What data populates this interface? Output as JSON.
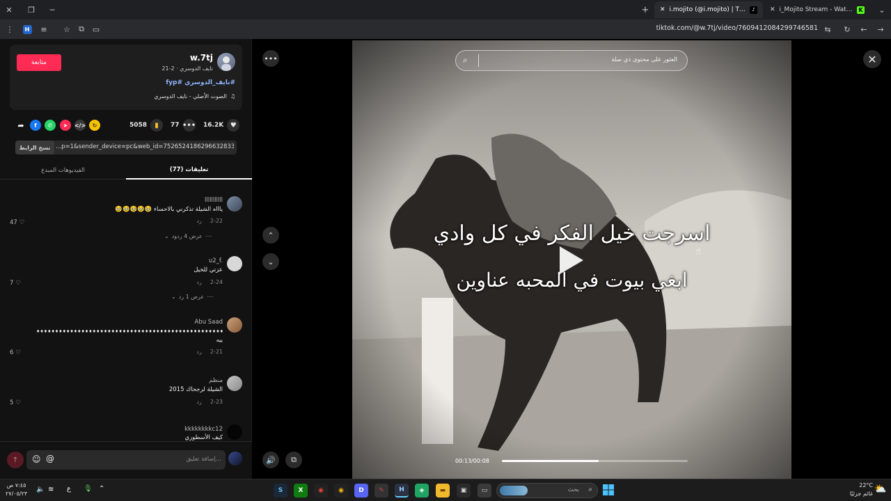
{
  "browser": {
    "tabs": [
      {
        "label": "i_Mojito Stream - Watch Liv"
      },
      {
        "label": "i.mojito (@i.mojito) | TikTok"
      }
    ],
    "url": "tiktok.com/@w.7tj/video/7609412084299746581"
  },
  "post": {
    "follow_label": "متابعة",
    "username": "w.7tj",
    "subline": "نايف الدوسري · 2-21",
    "hashtags": "#نايف_الدوسري #fyp",
    "sound": "الصوت الأصلي - نايف الدوسري",
    "likes": "16.2K",
    "comments": "77",
    "saves": "5058",
    "link": "...p=1&sender_device=pc&web_id=7526524186296632833",
    "copy_label": "نسخ الرابط",
    "tab_comments": "تعليقات (77)",
    "tab_creator": "الفيديوهات المبدع"
  },
  "comments": [
    {
      "name": "lllllllllll",
      "text": "ياااه الشيلة تذكرني بالاحساء 🥹🥹🥹🥹🥹",
      "date": "2-22",
      "reply": "رد",
      "likes": "47",
      "replies": "عرض 4 ردود"
    },
    {
      "name": "u2_f.",
      "text": "عزتي للخيل",
      "date": "2-24",
      "reply": "رد",
      "likes": "7",
      "replies": "عرض 1 رد"
    },
    {
      "name": "Abu Saad",
      "text": "♦♦♦♦♦♦♦♦♦♦♦♦♦♦♦♦♦♦♦♦♦♦♦♦♦♦♦♦♦♦♦♦♦♦♦♦♦♦♦♦♦♦♦♦♦♦♦♦♦♦♦♦♦♦♦♦♦♦♦♦♦♦♦♦♦♦♦♦♦♦♦♦♦♦♦♦♦♦♦♦♦",
      "text2": "ييه",
      "date": "2-21",
      "reply": "رد",
      "likes": "6"
    },
    {
      "name": "منظم",
      "text": "الشيلة لرجحاك 2015",
      "date": "2-23",
      "reply": "رد",
      "likes": "5"
    },
    {
      "name": "kkkkkkkkc12",
      "text": "كيف الأسطوري"
    }
  ],
  "input": {
    "placeholder": "إضافة تعليق..."
  },
  "video": {
    "search_placeholder": "العثور على محتوى ذي صلة",
    "caption_line1": "اسرجت خيل الفكر في كل وادي",
    "caption_line2": "ابغي بيوت في المحبه عناوين",
    "time": "00:13/00:08",
    "progress": 0.52
  },
  "taskbar": {
    "weather_temp": "22°C",
    "weather_text": "غائم جزئيًا",
    "search_placeholder": "بحث",
    "clock_time": "٧:٤٥ ص",
    "clock_date": "٢٧/٠٥/٢٣",
    "lang": "ع"
  },
  "colors": {
    "accent": "#fe2c55",
    "hashtag": "#8fb4ff",
    "page_bg": "#121212"
  }
}
